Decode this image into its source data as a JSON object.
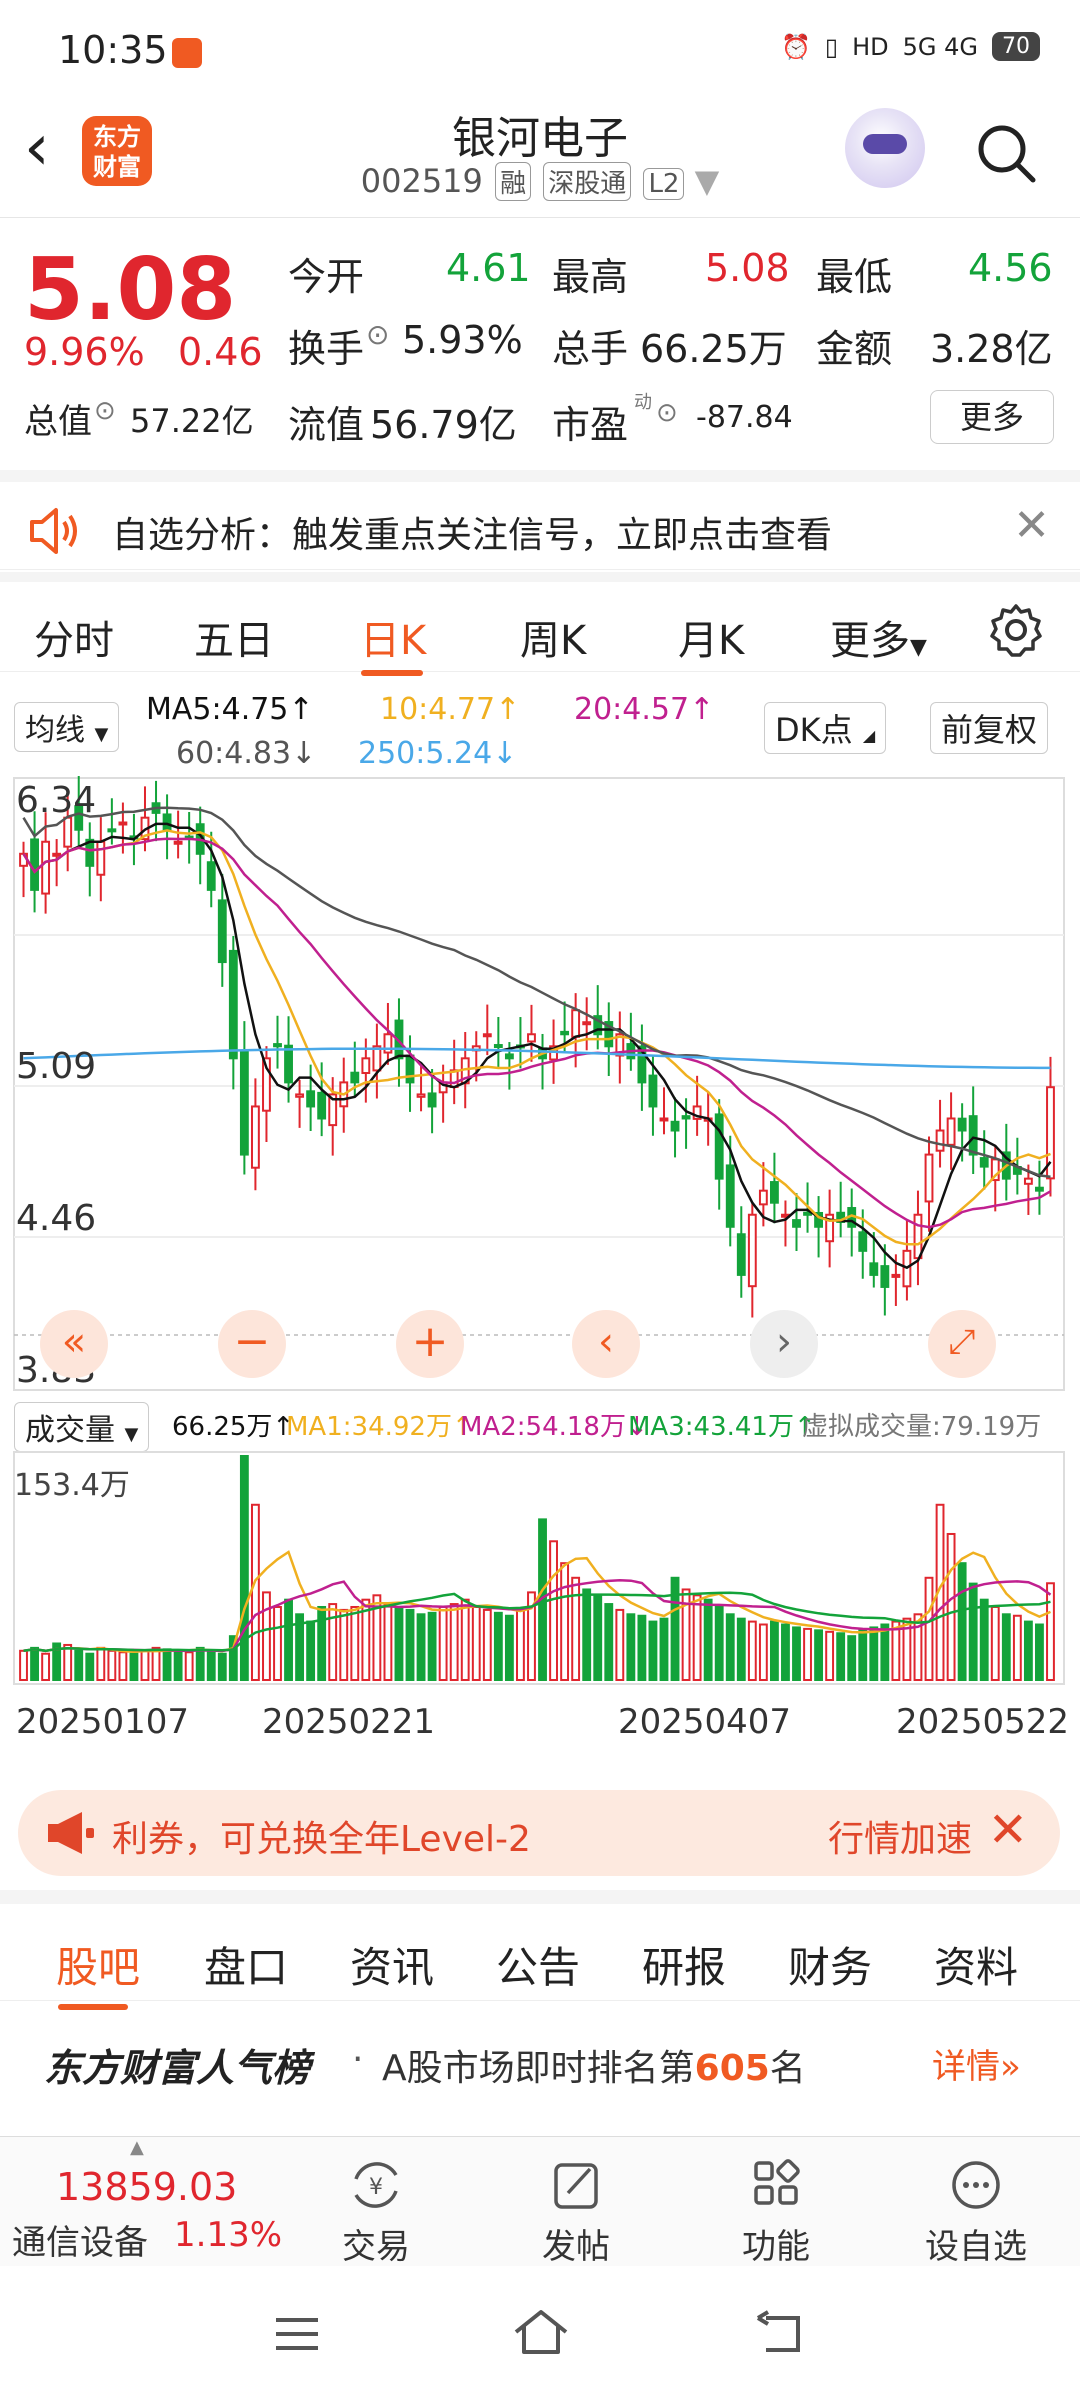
{
  "status_bar": {
    "time": "10:35",
    "battery": "70",
    "signal": "5G 4G"
  },
  "nav": {
    "logo_text": "东方财富",
    "stock_name": "银河电子",
    "stock_code": "002519",
    "tags": [
      "融",
      "深股通",
      "L2"
    ]
  },
  "quote": {
    "price": "5.08",
    "change_pct": "9.96%",
    "change": "0.46",
    "open_label": "今开",
    "open": "4.61",
    "high_label": "最高",
    "high": "5.08",
    "low_label": "最低",
    "low": "4.56",
    "turnover_label": "换手",
    "turnover": "5.93%",
    "volume_label": "总手",
    "volume": "66.25万",
    "amount_label": "金额",
    "amount": "3.28亿",
    "mktcap_label": "总值",
    "mktcap": "57.22亿",
    "float_label": "流值",
    "float": "56.79亿",
    "pe_label": "市盈",
    "pe_sup": "动",
    "pe": "-87.84",
    "more": "更多"
  },
  "notice": {
    "text": "自选分析：触发重点关注信号，立即点击查看"
  },
  "tabs": [
    "分时",
    "五日",
    "日K",
    "周K",
    "月K",
    "更多"
  ],
  "ma_legend": {
    "selector": "均线",
    "ma5": "MA5:4.75↑",
    "ma10": "10:4.77↑",
    "ma20": "20:4.57↑",
    "ma60": "60:4.83↓",
    "ma250": "250:5.24↓",
    "dk": "DK点",
    "fq": "前复权"
  },
  "price_axis": [
    "6.34",
    "5.09",
    "4.46",
    "3.83"
  ],
  "volume_legend": {
    "selector": "成交量",
    "vol": "66.25万↑",
    "ma1": "MA1:34.92万↑",
    "ma2": "MA2:54.18万↓",
    "ma3": "MA3:43.41万↑",
    "virtual": "虚拟成交量:79.19万",
    "axis_max": "153.4万"
  },
  "dates": [
    "20250107",
    "20250221",
    "20250407",
    "20250522"
  ],
  "colors": {
    "up": "#e0262e",
    "down": "#13a33a",
    "accent": "#f05a22",
    "ma5": "#111111",
    "ma10": "#f0b020",
    "ma20": "#c0208f",
    "ma60": "#555555",
    "ma250": "#4aa8e8"
  },
  "chart_data": {
    "type": "candlestick",
    "title": "",
    "ylim": [
      3.83,
      6.34
    ],
    "closes": [
      6.05,
      5.9,
      6.1,
      6.05,
      6.2,
      6.15,
      6.0,
      6.1,
      6.15,
      6.18,
      6.12,
      6.2,
      6.22,
      6.15,
      6.1,
      6.12,
      6.05,
      5.9,
      5.6,
      5.2,
      4.8,
      5.0,
      5.2,
      5.25,
      5.1,
      5.05,
      5.0,
      4.95,
      5.05,
      5.1,
      5.1,
      5.2,
      5.25,
      5.3,
      5.2,
      5.1,
      5.05,
      5.0,
      5.1,
      5.15,
      5.2,
      5.25,
      5.3,
      5.25,
      5.2,
      5.25,
      5.3,
      5.2,
      5.25,
      5.3,
      5.4,
      5.35,
      5.3,
      5.25,
      5.3,
      5.2,
      5.1,
      5.0,
      4.95,
      4.9,
      4.95,
      5.0,
      4.95,
      4.7,
      4.5,
      4.3,
      4.55,
      4.65,
      4.6,
      4.55,
      4.5,
      4.55,
      4.5,
      4.55,
      4.52,
      4.5,
      4.4,
      4.3,
      4.25,
      4.3,
      4.4,
      4.55,
      4.8,
      4.9,
      4.95,
      4.9,
      4.8,
      4.75,
      4.78,
      4.7,
      4.72,
      4.7,
      4.65,
      5.08
    ],
    "volumes": [
      20,
      22,
      18,
      25,
      24,
      20,
      18,
      22,
      20,
      19,
      18,
      20,
      22,
      21,
      20,
      19,
      22,
      20,
      18,
      30,
      153.4,
      120,
      60,
      50,
      55,
      45,
      40,
      50,
      52,
      48,
      50,
      55,
      58,
      52,
      50,
      48,
      45,
      46,
      50,
      52,
      55,
      50,
      48,
      46,
      44,
      48,
      60,
      110,
      95,
      80,
      70,
      62,
      58,
      52,
      48,
      45,
      44,
      40,
      42,
      70,
      62,
      58,
      55,
      50,
      45,
      42,
      40,
      38,
      40,
      38,
      36,
      35,
      34,
      33,
      32,
      30,
      34,
      36,
      38,
      40,
      42,
      45,
      70,
      120,
      100,
      80,
      66,
      55,
      50,
      45,
      44,
      40,
      38,
      66.25
    ]
  },
  "promo": {
    "text": "利券，可兑换全年Level-2",
    "right": "行情加速"
  },
  "subtabs": [
    "股吧",
    "盘口",
    "资讯",
    "公告",
    "研报",
    "财务",
    "资料"
  ],
  "rank": {
    "title": "东方财富人气榜",
    "text_prefix": "A股市场即时排名第",
    "rank": "605",
    "text_suffix": "名",
    "detail": "详情"
  },
  "bottom": {
    "index_value": "13859.03",
    "index_name": "通信设备",
    "index_change": "1.13%",
    "buttons": [
      "交易",
      "发帖",
      "功能",
      "设自选"
    ]
  }
}
